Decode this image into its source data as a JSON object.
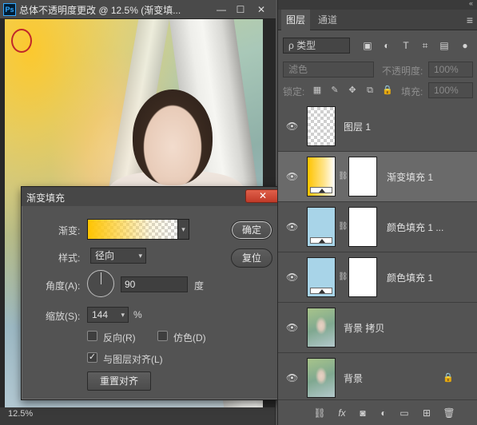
{
  "document": {
    "app_badge": "Ps",
    "title": "总体不透明度更改 @ 12.5% (渐变填...",
    "minimize": "—",
    "maximize": "☐",
    "close": "✕",
    "zoom_status": "12.5%"
  },
  "dialog": {
    "title": "渐变填充",
    "close": "✕",
    "gradient_label": "渐变:",
    "style_label": "样式:",
    "style_value": "径向",
    "angle_label": "角度(A):",
    "angle_value": "90",
    "angle_unit": "度",
    "scale_label": "缩放(S):",
    "scale_value": "144",
    "scale_unit": "%",
    "reverse_label": "反向(R)",
    "reverse_checked": false,
    "dither_label": "仿色(D)",
    "dither_checked": false,
    "align_label": "与图层对齐(L)",
    "align_checked": true,
    "realign_button": "重置对齐",
    "ok_button": "确定",
    "reset_button": "复位"
  },
  "panel": {
    "collapse": "«",
    "tabs": [
      {
        "label": "图层",
        "active": true
      },
      {
        "label": "通道",
        "active": false
      }
    ],
    "menu_icon": "≡",
    "filter_placeholder": "ρ 类型",
    "filter_icons": [
      "image-filter-icon",
      "adjustment-filter-icon",
      "type-filter-icon",
      "shape-filter-icon",
      "smart-object-filter-icon",
      "filter-toggle-icon"
    ],
    "blend_mode": "滤色",
    "opacity_label": "不透明度:",
    "opacity_value": "100%",
    "lock_label": "锁定:",
    "fill_label": "填充:",
    "fill_value": "100%",
    "layers": [
      {
        "name": "图层 1",
        "visible": true,
        "selected": false,
        "thumb": "checker",
        "mask": false,
        "locked": false
      },
      {
        "name": "渐变填充 1",
        "visible": true,
        "selected": true,
        "thumb": "gradient",
        "mask": true,
        "locked": false
      },
      {
        "name": "颜色填充 1 ...",
        "visible": true,
        "selected": false,
        "thumb": "blue",
        "mask": true,
        "locked": false
      },
      {
        "name": "颜色填充 1",
        "visible": true,
        "selected": false,
        "thumb": "blue",
        "mask": true,
        "locked": false
      },
      {
        "name": "背景 拷贝",
        "visible": true,
        "selected": false,
        "thumb": "photo",
        "mask": false,
        "locked": false
      },
      {
        "name": "背景",
        "visible": true,
        "selected": false,
        "thumb": "photo",
        "mask": false,
        "locked": true
      }
    ],
    "footer_icons": [
      "link-layers-icon",
      "fx-icon",
      "add-mask-icon",
      "adjustment-layer-icon",
      "new-group-icon",
      "new-layer-icon",
      "delete-layer-icon"
    ]
  },
  "colors": {
    "gradient_start": "#ffc400",
    "color_fill": "#a8d4e8",
    "selected_row": "#6a6a6a"
  }
}
